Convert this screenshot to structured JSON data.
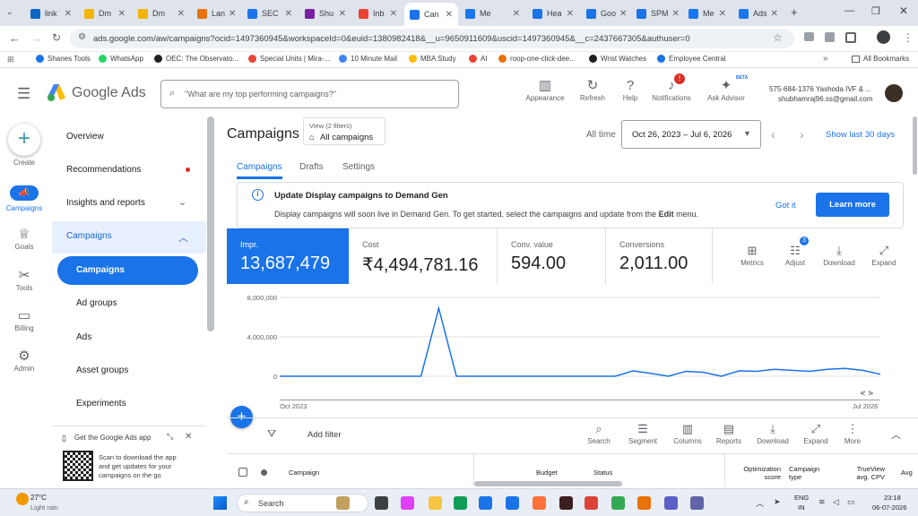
{
  "browser": {
    "tabs": [
      {
        "label": "link",
        "color": "#0a66c2"
      },
      {
        "label": "Dm",
        "color": "#f4b400"
      },
      {
        "label": "Dm",
        "color": "#f4b400"
      },
      {
        "label": "Lan",
        "color": "#e8710a"
      },
      {
        "label": "SEC",
        "color": "#1a73e8"
      },
      {
        "label": "Shu",
        "color": "#7b1fa2"
      },
      {
        "label": "Inb",
        "color": "#ea4335"
      },
      {
        "label": "Can",
        "color": "#1a73e8"
      },
      {
        "label": "Me",
        "color": "#1877f2"
      },
      {
        "label": "Hea",
        "color": "#1a73e8"
      },
      {
        "label": "Goo",
        "color": "#1a73e8"
      },
      {
        "label": "SPM",
        "color": "#1a73e8"
      },
      {
        "label": "Me",
        "color": "#1877f2"
      },
      {
        "label": "Ads",
        "color": "#1877f2"
      }
    ],
    "url": "ads.google.com/aw/campaigns?ocid=1497360945&workspaceId=0&euid=1380982418&__u=9650911609&uscid=1497360945&__c=2437667305&authuser=0",
    "bookmarks": [
      "Shanes Tools",
      "WhatsApp",
      "OEC: The Observato...",
      "Special Units | Mira-...",
      "10 Minute Mail",
      "MBA Study",
      "AI",
      "roop-one-click-dee...",
      "Wrist Watches",
      "Employee Central"
    ],
    "all_bookmarks": "All Bookmarks"
  },
  "header": {
    "product": "Google Ads",
    "search_placeholder": "\"What are my top performing campaigns?\"",
    "icons": [
      {
        "label": "Appearance",
        "icon": "appearance-icon",
        "glyph": "▥"
      },
      {
        "label": "Refresh",
        "icon": "refresh-icon",
        "glyph": "↻"
      },
      {
        "label": "Help",
        "icon": "help-icon",
        "glyph": "?"
      },
      {
        "label": "Notifications",
        "icon": "bell-icon",
        "glyph": "♪"
      },
      {
        "label": "Ask Advisor",
        "icon": "advisor-icon",
        "glyph": "✦"
      }
    ],
    "notif_count": "!",
    "beta": "BETA",
    "account_line1": "575-684-1376 Yashoda IVF & ...",
    "account_line2": "shubhamraj96.ss@gmail.com"
  },
  "rail": [
    {
      "label": "Create",
      "icon": "plus-icon"
    },
    {
      "label": "Campaigns",
      "icon": "megaphone-icon"
    },
    {
      "label": "Goals",
      "icon": "trophy-icon"
    },
    {
      "label": "Tools",
      "icon": "tools-icon"
    },
    {
      "label": "Billing",
      "icon": "card-icon"
    },
    {
      "label": "Admin",
      "icon": "gear-icon"
    }
  ],
  "nav": {
    "items": [
      "Overview",
      "Recommendations",
      "Insights and reports",
      "Campaigns",
      "Campaigns",
      "Ad groups",
      "Ads",
      "Asset groups",
      "Experiments"
    ],
    "app_promo_title": "Get the Google Ads app",
    "app_promo_text": "Scan to download the app and get updates for your campaigns on the go"
  },
  "main": {
    "title": "Campaigns",
    "view_label": "View (2 filters)",
    "view_value": "All campaigns",
    "all_time": "All time",
    "date_range": "Oct 26, 2023 – Jul 6, 2026",
    "show_last": "Show last 30 days",
    "tabs": [
      "Campaigns",
      "Drafts",
      "Settings"
    ],
    "banner_title": "Update Display campaigns to Demand Gen",
    "banner_text_pre": "Display campaigns will soon live in Demand Gen. To get started, select the campaigns and update from the ",
    "banner_text_bold": "Edit",
    "banner_text_post": " menu.",
    "got_it": "Got it",
    "learn_more": "Learn more",
    "cards": [
      {
        "label": "Impr.",
        "value": "13,687,479"
      },
      {
        "label": "Cost",
        "value": "₹4,494,781.16"
      },
      {
        "label": "Conv. value",
        "value": "594.00"
      },
      {
        "label": "Conversions",
        "value": "2,011.00"
      }
    ],
    "card_tools": [
      "Metrics",
      "Adjust",
      "Download",
      "Expand"
    ],
    "adjust_badge": "3",
    "add_filter": "Add filter",
    "table_tools": [
      "Search",
      "Segment",
      "Columns",
      "Reports",
      "Download",
      "Expand",
      "More"
    ],
    "columns": [
      "Campaign",
      "Budget",
      "Status",
      "Optimization score",
      "Campaign type",
      "TrueView avg. CPV",
      "Avg"
    ]
  },
  "chart_data": {
    "type": "line",
    "yticks": [
      "8,000,000",
      "4,000,000",
      "0"
    ],
    "ylim": [
      0,
      8000000
    ],
    "xlabels": [
      "Oct 2023",
      "Jul 2026"
    ],
    "values": [
      0,
      0,
      0,
      0,
      0,
      0,
      0,
      0,
      0,
      6900000,
      0,
      0,
      0,
      0,
      0,
      0,
      0,
      0,
      0,
      0,
      550000,
      300000,
      0,
      500000,
      400000,
      0,
      550000,
      500000,
      700000,
      600000,
      500000,
      700000,
      800000,
      600000,
      200000
    ]
  },
  "taskbar": {
    "weather_temp": "27°C",
    "weather_desc": "Light rain",
    "search": "Search",
    "lang1": "ENG",
    "lang2": "IN",
    "time": "23:18",
    "date": "06-07-2026"
  }
}
